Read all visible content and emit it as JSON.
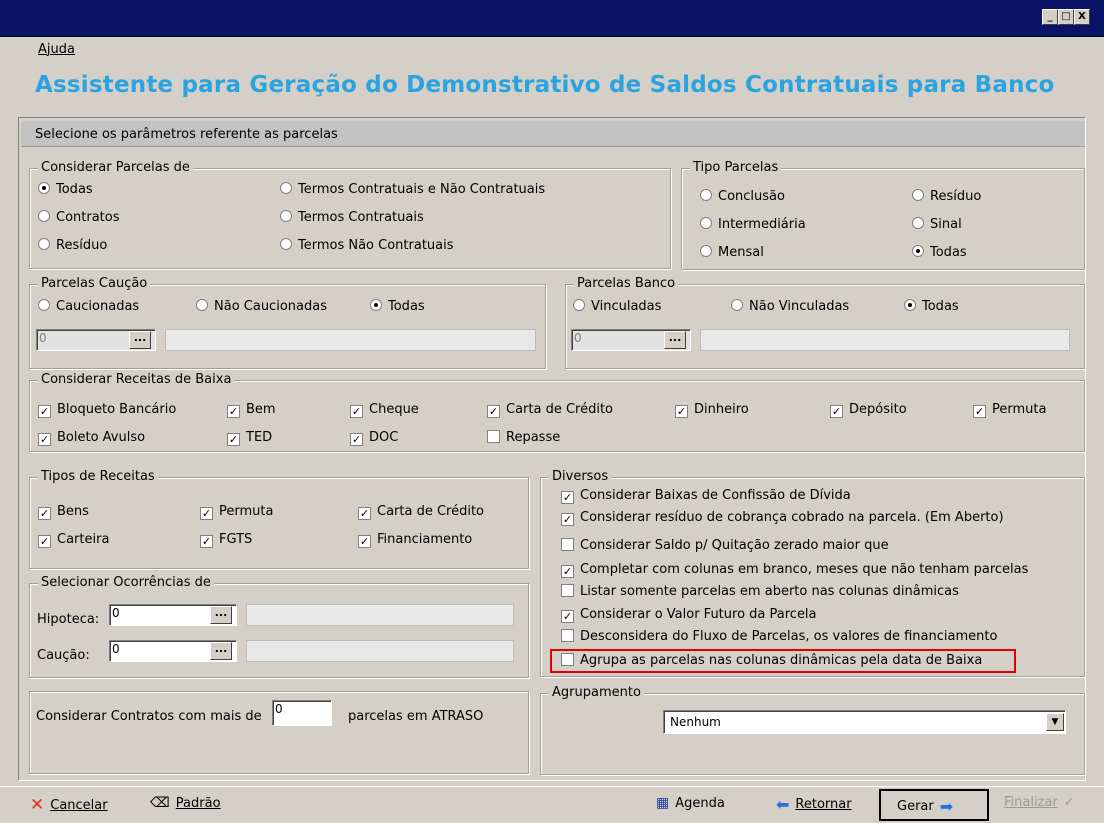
{
  "window": {
    "minimize": "_",
    "maximize": "□",
    "close": "X"
  },
  "menu": {
    "help": "Ajuda"
  },
  "heading": "Assistente para Geração do Demonstrativo de Saldos Contratuais para Banco",
  "section_header": "Selecione os parâmetros referente as parcelas",
  "considerar_parcelas": {
    "title": "Considerar Parcelas de",
    "options": [
      {
        "label": "Todas",
        "selected": true
      },
      {
        "label": "Contratos",
        "selected": false
      },
      {
        "label": "Resíduo",
        "selected": false
      },
      {
        "label": "Termos Contratuais e Não Contratuais",
        "selected": false
      },
      {
        "label": "Termos Contratuais",
        "selected": false
      },
      {
        "label": "Termos Não Contratuais",
        "selected": false
      }
    ]
  },
  "tipo_parcelas": {
    "title": "Tipo Parcelas",
    "options": [
      {
        "label": "Conclusão",
        "selected": false
      },
      {
        "label": "Intermediária",
        "selected": false
      },
      {
        "label": "Mensal",
        "selected": false
      },
      {
        "label": "Resíduo",
        "selected": false
      },
      {
        "label": "Sinal",
        "selected": false
      },
      {
        "label": "Todas",
        "selected": true
      }
    ]
  },
  "parcelas_caucao": {
    "title": "Parcelas Caução",
    "options": [
      {
        "label": "Caucionadas",
        "selected": false
      },
      {
        "label": "Não Caucionadas",
        "selected": false
      },
      {
        "label": "Todas",
        "selected": true
      }
    ],
    "code_value": "0",
    "dots": "..."
  },
  "parcelas_banco": {
    "title": "Parcelas Banco",
    "options": [
      {
        "label": "Vinculadas",
        "selected": false
      },
      {
        "label": "Não Vinculadas",
        "selected": false
      },
      {
        "label": "Todas",
        "selected": true
      }
    ],
    "code_value": "0",
    "dots": "..."
  },
  "receitas_baixa": {
    "title": "Considerar Receitas de Baixa",
    "items": [
      {
        "label": "Bloqueto Bancário",
        "checked": true
      },
      {
        "label": "Bem",
        "checked": true
      },
      {
        "label": "Cheque",
        "checked": true
      },
      {
        "label": "Carta de Crédito",
        "checked": true
      },
      {
        "label": "Dinheiro",
        "checked": true
      },
      {
        "label": "Depósito",
        "checked": true
      },
      {
        "label": "Permuta",
        "checked": true
      },
      {
        "label": "Boleto Avulso",
        "checked": true
      },
      {
        "label": "TED",
        "checked": true
      },
      {
        "label": "DOC",
        "checked": true
      },
      {
        "label": "Repasse",
        "checked": false
      }
    ]
  },
  "tipos_receitas": {
    "title": "Tipos de Receitas",
    "items": [
      {
        "label": "Bens",
        "checked": true
      },
      {
        "label": "Permuta",
        "checked": true
      },
      {
        "label": "Carta de Crédito",
        "checked": true
      },
      {
        "label": "Carteira",
        "checked": true
      },
      {
        "label": "FGTS",
        "checked": true
      },
      {
        "label": "Financiamento",
        "checked": true
      }
    ]
  },
  "ocorrencias": {
    "title": "Selecionar Ocorrências de",
    "hipoteca_label": "Hipoteca:",
    "hipoteca_value": "0",
    "caucao_label": "Caução:",
    "caucao_value": "0",
    "dots": "..."
  },
  "diversos": {
    "title": "Diversos",
    "items": [
      {
        "label": "Considerar Baixas de Confissão de Dívida",
        "checked": true
      },
      {
        "label": "Considerar resíduo de cobrança cobrado na parcela. (Em Aberto)",
        "checked": true
      },
      {
        "label": "Considerar Saldo p/ Quitação zerado maior que",
        "checked": false
      },
      {
        "label": "Completar com colunas em branco, meses que não tenham parcelas",
        "checked": true
      },
      {
        "label": "Listar somente parcelas em aberto nas colunas dinâmicas",
        "checked": false
      },
      {
        "label": "Considerar o Valor Futuro da Parcela",
        "checked": true
      },
      {
        "label": "Desconsidera do Fluxo de Parcelas, os valores de financiamento",
        "checked": false
      },
      {
        "label": "Agrupa as parcelas nas colunas dinâmicas pela data de Baixa",
        "checked": false
      }
    ]
  },
  "atraso": {
    "prefix": "Considerar Contratos com mais de",
    "value": "0",
    "suffix": "parcelas em ATRASO"
  },
  "agrupamento": {
    "title": "Agrupamento",
    "selected": "Nenhum"
  },
  "bottom": {
    "cancelar": "Cancelar",
    "padrao": "Padrão",
    "agenda": "Agenda",
    "retornar": "Retornar",
    "gerar": "Gerar",
    "finalizar": "Finalizar"
  },
  "colors": {
    "heading": "#2aa3e0",
    "titlebar": "#0a1466",
    "highlight": "#e00000"
  }
}
